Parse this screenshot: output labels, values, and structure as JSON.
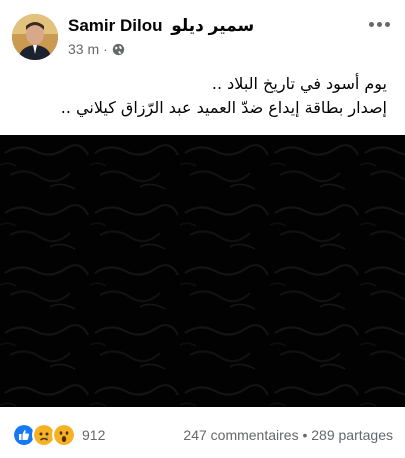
{
  "post": {
    "author_name": "Samir Dilou",
    "author_name_ar": "سمير ديلو",
    "time": "33 m",
    "privacy_icon": "globe-icon",
    "text_line_1": "يوم أسود في تاريخ البلاد ..",
    "text_line_2": "إصدار بطاقة إيداع ضدّ العميد عبد الرّزاق كيلاني .."
  },
  "reactions": {
    "icons": [
      "like-icon",
      "sad-icon",
      "wow-icon"
    ],
    "count": "912"
  },
  "stats": {
    "comments": "247 commentaires",
    "separator": "•",
    "shares": "289 partages"
  },
  "colors": {
    "secondary_text": "#65676b",
    "like_blue": "#1877f2",
    "emoji_yellow": "#f7b125",
    "media_bg": "#020202"
  }
}
